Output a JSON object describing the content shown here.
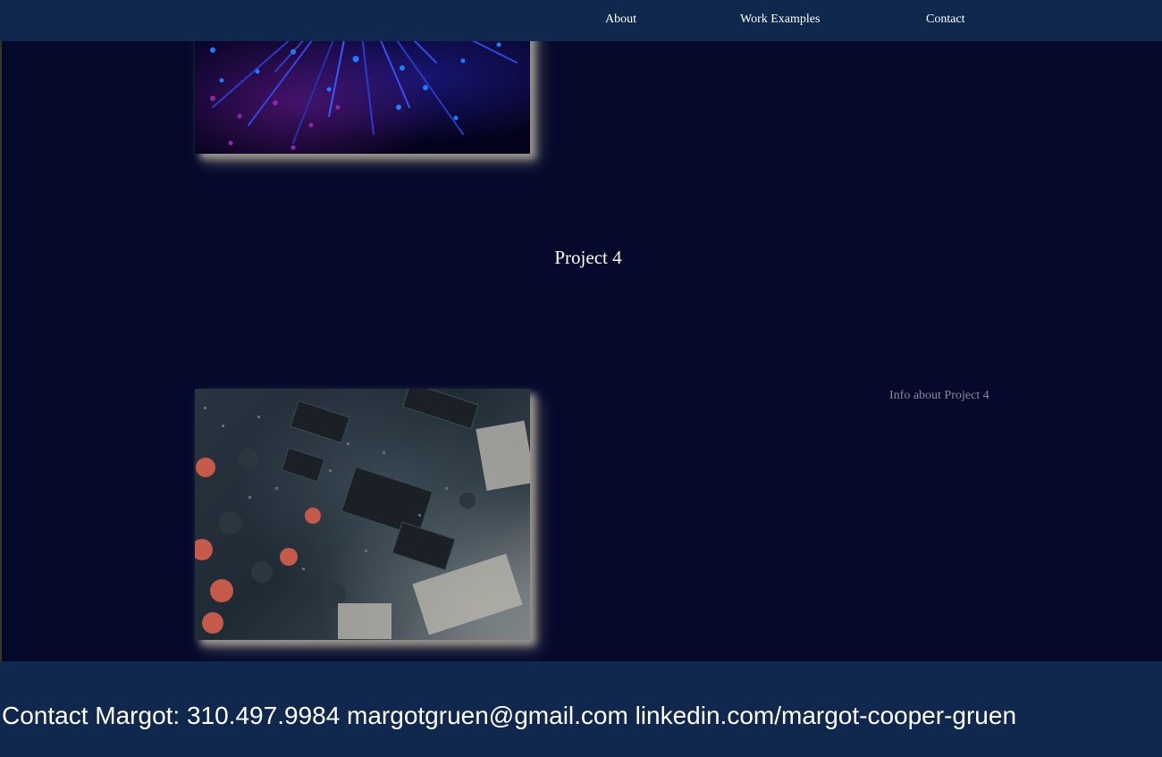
{
  "nav": {
    "about": "About",
    "work_examples": "Work Examples",
    "contact": "Contact"
  },
  "project": {
    "title": "Project 4",
    "info": "Info about Project 4"
  },
  "footer": {
    "text": "Contact Margot: 310.497.9984 margotgruen@gmail.com linkedin.com/margot-cooper-gruen"
  },
  "colors": {
    "page_background": "#050a2c",
    "navbar_background": "#10284d",
    "footer_background": "#10284d",
    "info_text": "#8a8a95"
  }
}
